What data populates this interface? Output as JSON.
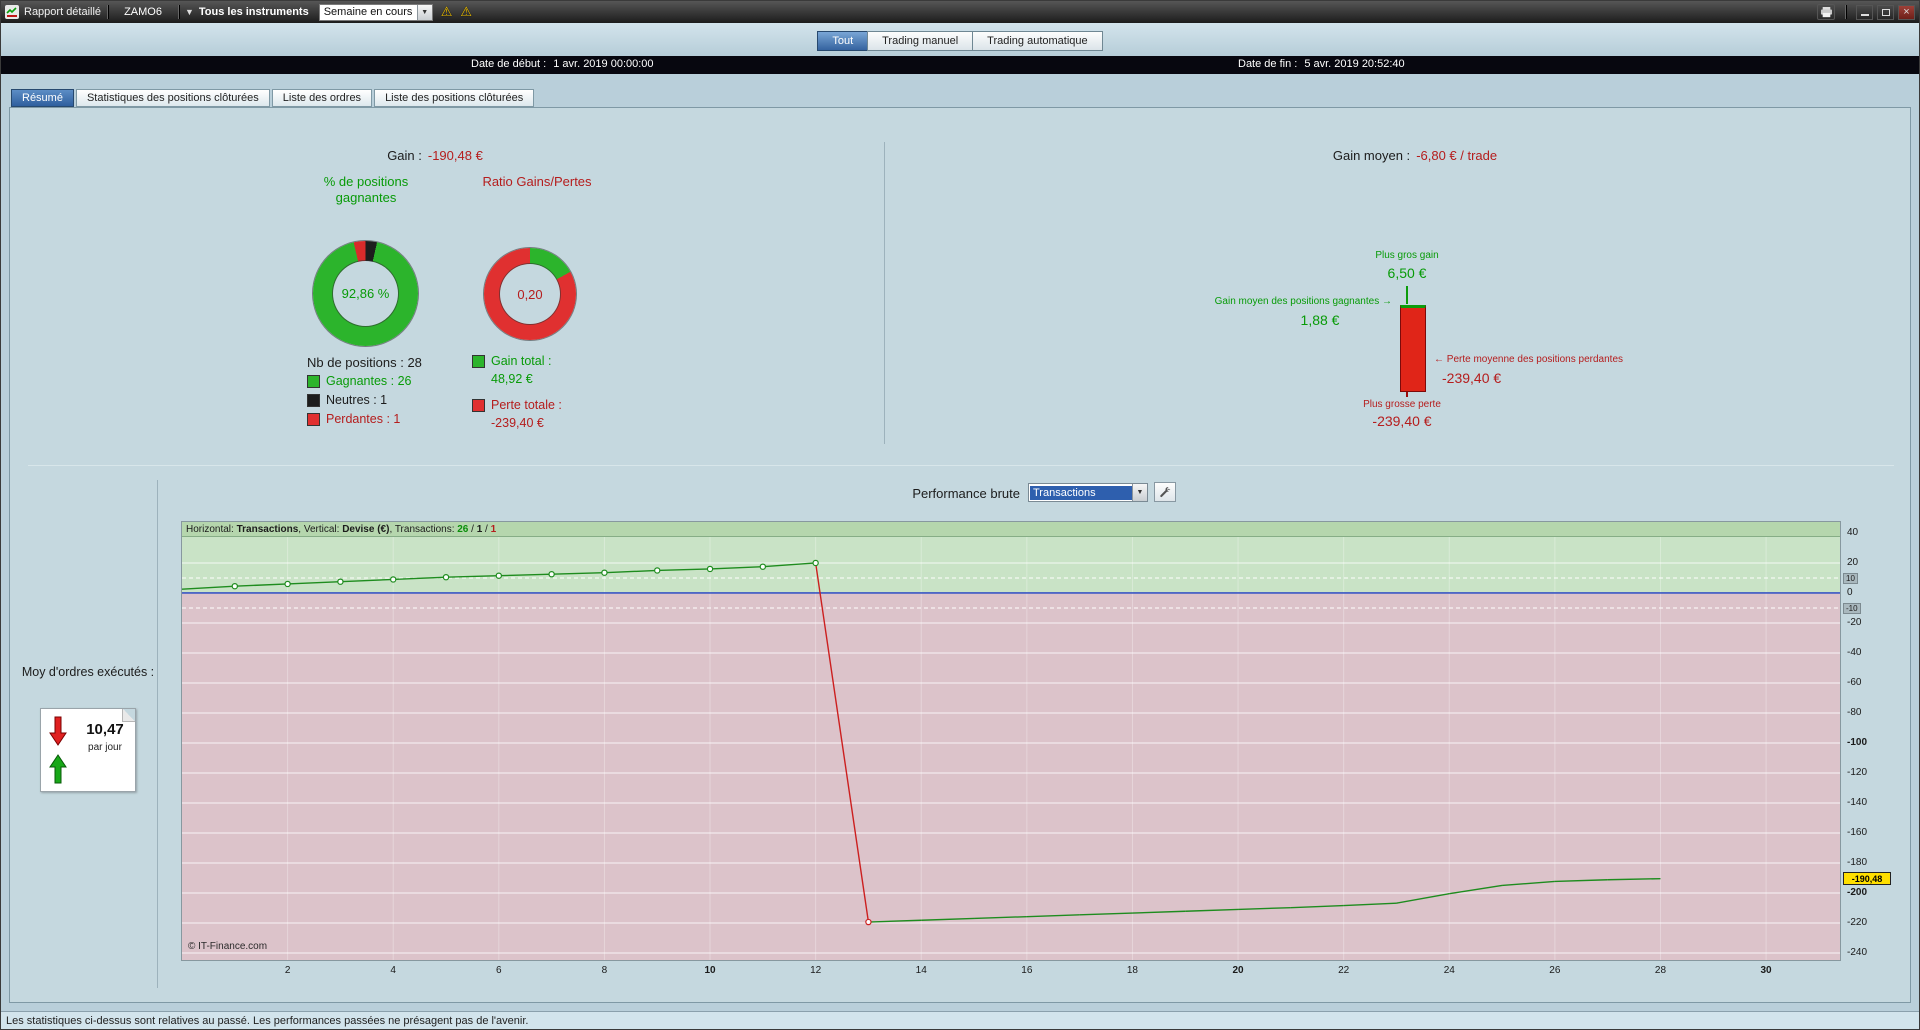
{
  "window": {
    "title": "Rapport détaillé",
    "doc_tab": "ZAMO6",
    "instruments": "Tous les instruments",
    "period": "Semaine en cours"
  },
  "main_tabs": [
    {
      "label": "Tout",
      "selected": true
    },
    {
      "label": "Trading manuel",
      "selected": false
    },
    {
      "label": "Trading automatique",
      "selected": false
    }
  ],
  "dates": {
    "start_label": "Date de début :",
    "start_value": "1 avr. 2019 00:00:00",
    "end_label": "Date de fin :",
    "end_value": "5 avr. 2019 20:52:40"
  },
  "subtabs": [
    {
      "label": "Résumé",
      "selected": true
    },
    {
      "label": "Statistiques des positions clôturées",
      "selected": false
    },
    {
      "label": "Liste des ordres",
      "selected": false
    },
    {
      "label": "Liste des positions clôturées",
      "selected": false
    }
  ],
  "summary": {
    "gain_label": "Gain :",
    "gain_value": "-190,48 €",
    "winners_title": "% de positions gagnantes",
    "winners_value": "92,86 %",
    "ratio_title": "Ratio Gains/Pertes",
    "ratio_value": "0,20",
    "positions_count": "Nb de positions : 28",
    "legend_winners": "Gagnantes : 26",
    "legend_neutral": "Neutres : 1",
    "legend_losers": "Perdantes : 1",
    "total_gain_label": "Gain total :",
    "total_gain_value": "48,92 €",
    "total_loss_label": "Perte totale :",
    "total_loss_value": "-239,40 €",
    "donut_winners": {
      "win": 92.86,
      "neutral": 3.57,
      "loss": 3.57
    },
    "donut_ratio": {
      "gain_share": 17.0
    },
    "avg_gain_label": "Gain moyen :",
    "avg_gain_value": "-6,80 € / trade",
    "biggest_gain_label": "Plus gros gain",
    "biggest_gain_value": "6,50 €",
    "avg_win_label": "Gain moyen des positions gagnantes",
    "avg_win_value": "1,88 €",
    "avg_loss_label": "Perte moyenne des positions perdantes",
    "avg_loss_value": "-239,40 €",
    "biggest_loss_label": "Plus grosse perte",
    "biggest_loss_value": "-239,40 €"
  },
  "performance": {
    "title": "Performance brute",
    "selector_value": "Transactions",
    "avg_orders_label": "Moy d'ordres exécutés :",
    "avg_orders_value": "10,47",
    "avg_orders_unit": "par jour"
  },
  "chart_data": {
    "type": "line",
    "title": "Performance brute",
    "xlabel": "Transactions",
    "ylabel": "Devise (€)",
    "header_segments": [
      {
        "t": "Horizontal: ",
        "c": "dark"
      },
      {
        "t": "Transactions",
        "c": "dark",
        "b": true
      },
      {
        "t": ", Vertical: ",
        "c": "dark"
      },
      {
        "t": "Devise (€)",
        "c": "dark",
        "b": true
      },
      {
        "t": ", Transactions: ",
        "c": "dark"
      },
      {
        "t": "26",
        "c": "green",
        "b": true
      },
      {
        "t": " / ",
        "c": "dark"
      },
      {
        "t": "1",
        "c": "dark",
        "b": true
      },
      {
        "t": " / ",
        "c": "dark"
      },
      {
        "t": "1",
        "c": "red",
        "b": true
      }
    ],
    "x": [
      0,
      1,
      2,
      3,
      4,
      5,
      6,
      7,
      8,
      9,
      10,
      11,
      12,
      13,
      14,
      15,
      16,
      17,
      18,
      19,
      20,
      21,
      22,
      23,
      24,
      25,
      26,
      27,
      28
    ],
    "values": [
      2.5,
      4.5,
      6,
      7.5,
      9,
      10.5,
      11.5,
      12.5,
      13.5,
      15,
      16,
      17.5,
      20,
      -219.4,
      -218.2,
      -217,
      -215.8,
      -214.6,
      -213.4,
      -212.2,
      -211,
      -209.8,
      -208.4,
      -206.8,
      -200.5,
      -195,
      -192.3,
      -191.2,
      -190.48
    ],
    "marker_indices": [
      1,
      2,
      3,
      4,
      5,
      6,
      7,
      8,
      9,
      10,
      11,
      12,
      13
    ],
    "x_ticks": [
      2,
      4,
      6,
      8,
      10,
      12,
      14,
      16,
      18,
      20,
      22,
      24,
      26,
      28,
      30
    ],
    "bold_x_ticks": [
      10,
      20,
      30
    ],
    "y_ticks": [
      40,
      20,
      0,
      -20,
      -40,
      -60,
      -80,
      -100,
      -120,
      -140,
      -160,
      -180,
      -200,
      -220,
      -240
    ],
    "bold_y_ticks": [
      -100,
      -200
    ],
    "dashed_levels": [
      10,
      -10
    ],
    "level_chips": [
      "10",
      "-10"
    ],
    "xlim": [
      0,
      31.4
    ],
    "ylim": [
      -244.7,
      47.3
    ],
    "final_value": -190.48,
    "final_label": "-190,48",
    "pos_band_color": "#c9e3c6",
    "neg_band_color": "#dcc3ca",
    "line_up_color": "#1e8c1e",
    "line_down_color": "#cc1f1f",
    "zero_line_color": "#3a57c4",
    "copyright": "© IT-Finance.com"
  },
  "status_text": "Les statistiques ci-dessus sont relatives au passé. Les performances passées ne présagent pas de l'avenir."
}
